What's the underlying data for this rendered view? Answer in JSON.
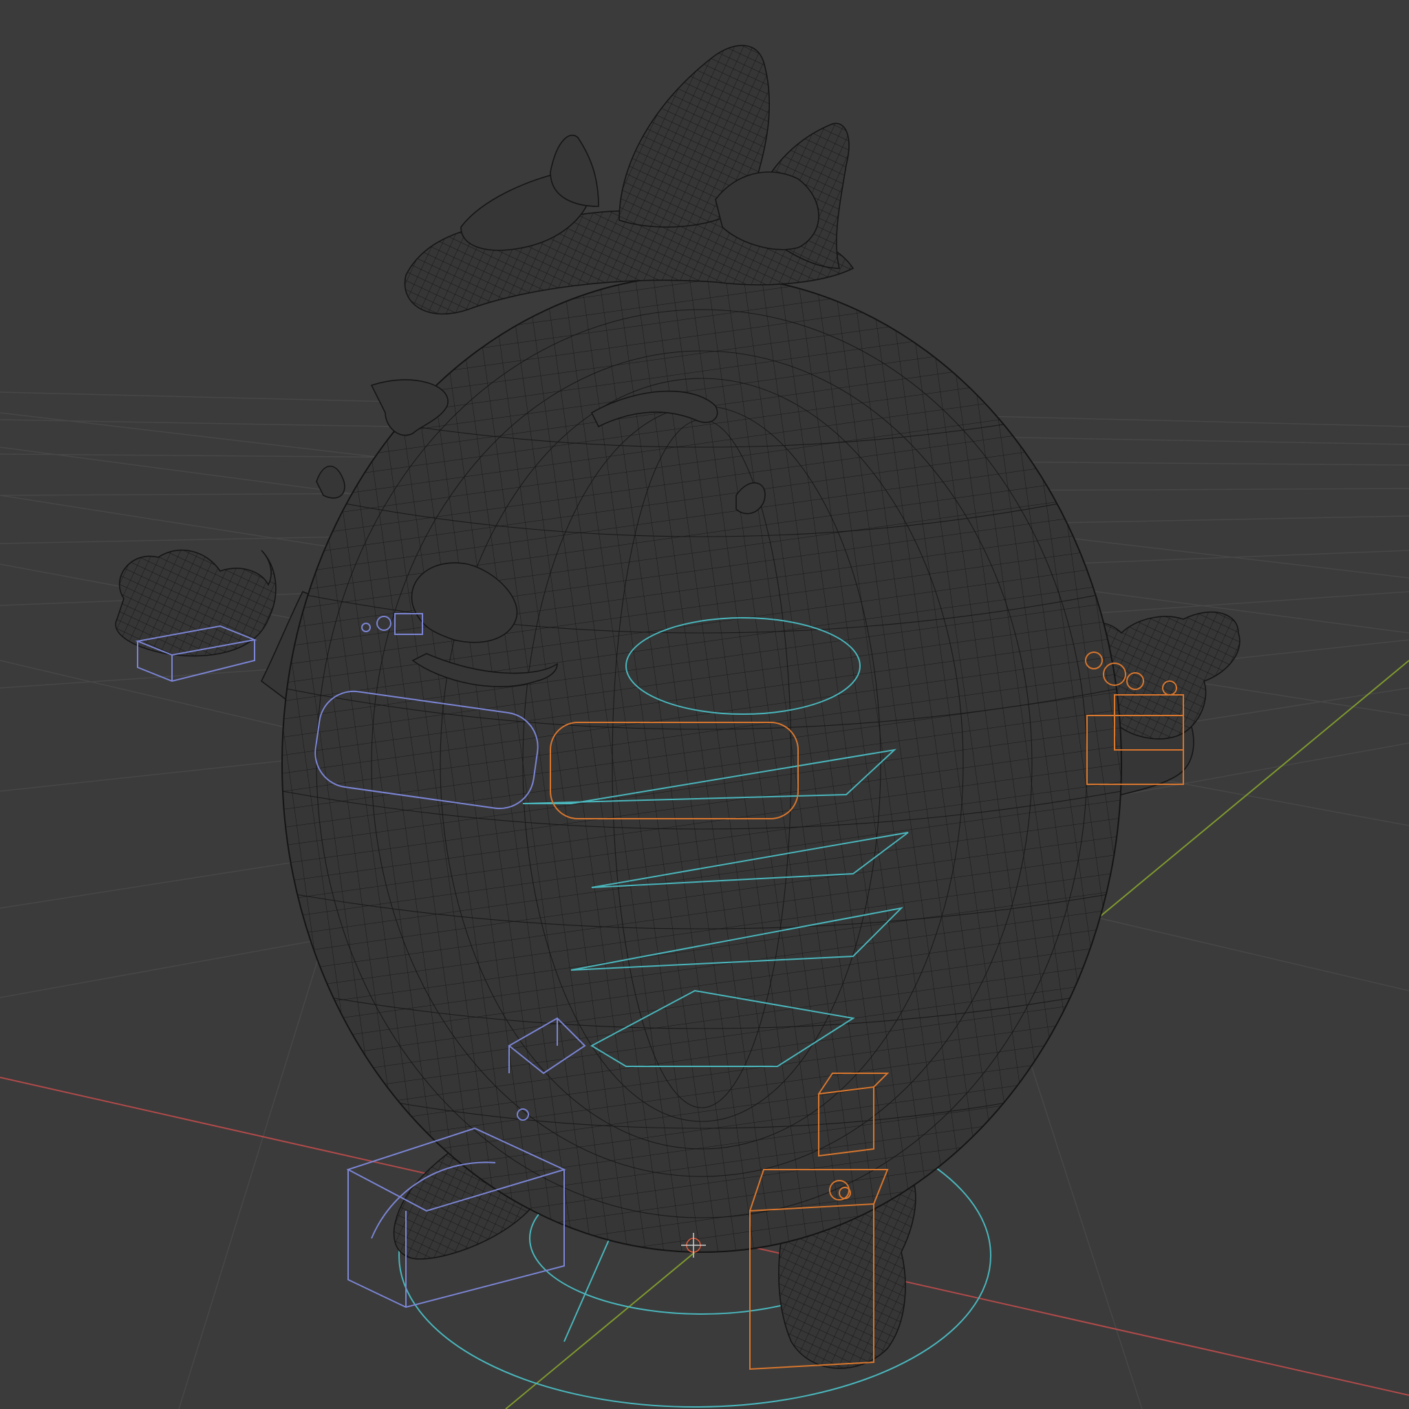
{
  "viewport": {
    "mode": "wireframe",
    "background_color": "#3b3b3b",
    "grid_color": "#4a4a4a",
    "axis_x_color": "#b24a4a",
    "axis_y_color": "#7f9a2e",
    "mesh_wire_color": "#151515",
    "rig_left_color": "#7c86d6",
    "rig_right_color": "#d9772e",
    "rig_center_color": "#4ab7bd"
  },
  "scene": {
    "object": "character-mesh",
    "objects": [
      "body",
      "head-hair",
      "left-hand",
      "right-hand",
      "left-foot",
      "right-foot"
    ],
    "rig_controls": [
      "root-circle",
      "torso-controls",
      "left-arm-ik",
      "right-arm-ik",
      "left-leg-ik",
      "right-leg-ik"
    ],
    "icons": [
      "3d-cursor-icon"
    ]
  }
}
